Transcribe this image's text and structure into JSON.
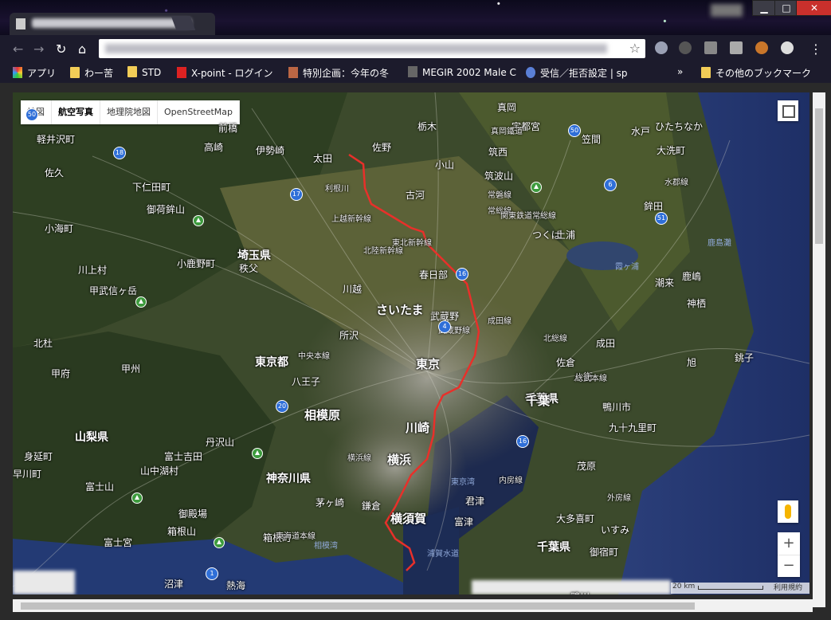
{
  "browser": {
    "apps_label": "アプリ",
    "bookmarks": [
      {
        "label": "わー苦",
        "icon": "folder-icon"
      },
      {
        "label": "STD",
        "icon": "folder-icon"
      },
      {
        "label": "X-point - ログイン",
        "icon": "xpoint-icon"
      },
      {
        "label": "特別企画：今年の冬",
        "icon": "site-icon"
      },
      {
        "label": "MEGIR 2002 Male C",
        "icon": "site-icon"
      },
      {
        "label": "受信／拒否設定 | sp",
        "icon": "site-icon"
      }
    ],
    "overflow_label": "»",
    "other_bookmarks": "その他のブックマーク"
  },
  "map": {
    "type_tabs": [
      "地図",
      "航空写真",
      "地理院地図",
      "OpenStreetMap"
    ],
    "selected_tab": 1,
    "zoom_in": "+",
    "zoom_out": "−",
    "scale_label": "20 km",
    "terms": "利用規約",
    "places": {
      "prefectures": [
        "埼玉県",
        "東京都",
        "山梨県",
        "神奈川県",
        "千葉県",
        "千葉県"
      ],
      "cities_big": [
        "さいたま",
        "東京",
        "千葉",
        "横浜",
        "川崎",
        "相模原",
        "横須賀"
      ],
      "cities": [
        "高崎",
        "前橋",
        "伊勢崎",
        "太田",
        "佐野",
        "栃木",
        "真岡",
        "宇都宮",
        "小山",
        "古河",
        "筑西",
        "笠間",
        "水戸",
        "ひたちなか",
        "大洗町",
        "つくば",
        "土浦",
        "鉾田",
        "鹿嶋",
        "潮来",
        "神栖",
        "旭",
        "銚子",
        "成田",
        "佐倉",
        "八街",
        "茂原",
        "君津",
        "いすみ",
        "御宿町",
        "大多喜町",
        "鴨川",
        "春日部",
        "川越",
        "所沢",
        "八王子",
        "武蔵野",
        "秩父",
        "小鹿野町",
        "甲府",
        "甲州",
        "北杜",
        "身延町",
        "早川町",
        "富士吉田",
        "富士宮",
        "御殿場",
        "箱根町",
        "熱海",
        "沼津",
        "茅ヶ崎",
        "鎌倉",
        "富津",
        "九十九里町",
        "軽井沢町",
        "佐久",
        "下仁田町",
        "小海町",
        "川上村",
        "山中湖村",
        "鴨川市"
      ],
      "mountains": [
        "御荷鉾山",
        "甲武信ヶ岳",
        "丹沢山",
        "富士山",
        "箱根山",
        "筑波山"
      ],
      "water": [
        "霞ヶ浦",
        "東京湾",
        "浦賀水道",
        "相模湾",
        "鹿島灘"
      ],
      "roads": [
        "北陸新幹線",
        "上越新幹線",
        "東北新幹線",
        "常磐線",
        "成田線",
        "総武本線",
        "内房線",
        "外房線",
        "武蔵野線",
        "東海道本線",
        "中央本線",
        "横浜線",
        "水郡線",
        "常総線",
        "関東鉄道常総線",
        "真岡鐵道",
        "北総線",
        "利根川"
      ],
      "shields": [
        "18",
        "17",
        "16",
        "4",
        "50",
        "6",
        "51",
        "20",
        "1",
        "16",
        "50"
      ]
    },
    "route_color": "#e8302a"
  }
}
